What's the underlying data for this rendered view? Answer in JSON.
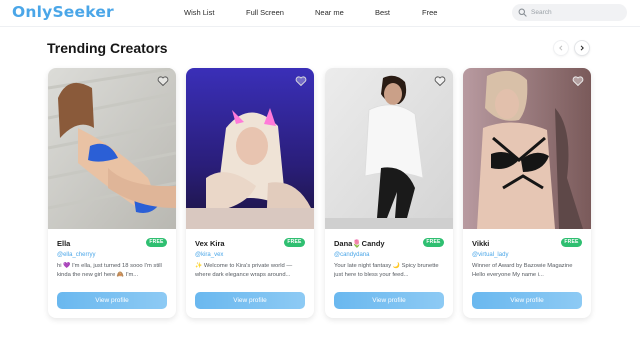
{
  "header": {
    "logo_part1": "Only",
    "logo_part2": "Seeker",
    "nav": [
      "Wish List",
      "Full Screen",
      "Near me",
      "Best",
      "Free"
    ],
    "search_placeholder": "Search"
  },
  "section": {
    "title": "Trending Creators"
  },
  "creators": [
    {
      "name": "Ella",
      "handle": "@ella_cherryy",
      "bio": "hi 💜 I'm ella, just turned 18 sooo I'm still kinda the new girl here 🙈 I'm...",
      "badge": "FREE",
      "button": "View profile"
    },
    {
      "name": "Vex Kira",
      "handle": "@kira_vex",
      "bio": "✨ Welcome to Kira's private world — where dark elegance wraps around...",
      "badge": "FREE",
      "button": "View profile"
    },
    {
      "name": "Dana🌷Candy",
      "handle": "@candydana",
      "bio": "Your late night fantasy 🌙 Spicy brunette just here to bless your feed...",
      "badge": "FREE",
      "button": "View profile"
    },
    {
      "name": "Vikki",
      "handle": "@virtual_lady",
      "bio": "Winner of Award by Bazowie Magazine Hello everyone My name i...",
      "badge": "FREE",
      "button": "View profile"
    }
  ],
  "colors": {
    "brand": "#4aa6e8",
    "free_badge": "#2fbf71",
    "button": "#7cc0f1"
  }
}
